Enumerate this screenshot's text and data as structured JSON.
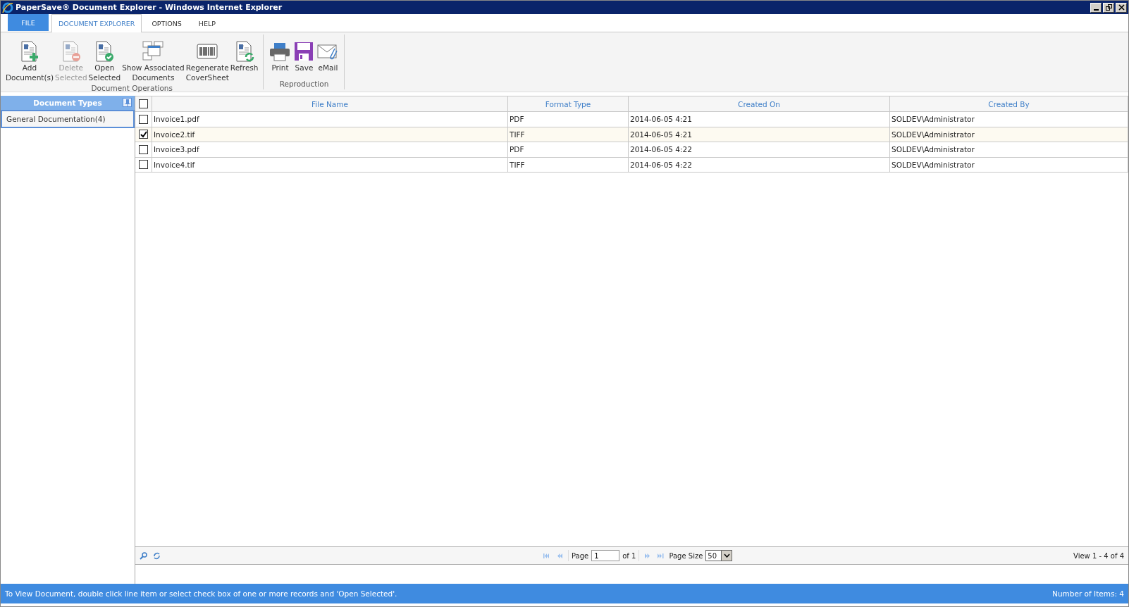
{
  "window": {
    "title": "PaperSave® Document Explorer - Windows Internet Explorer"
  },
  "ribbon_tabs": [
    {
      "label": "FILE",
      "kind": "file",
      "selected": false
    },
    {
      "label": "DOCUMENT EXPLORER",
      "kind": "tab",
      "selected": true
    },
    {
      "label": "OPTIONS",
      "kind": "tab",
      "selected": false
    },
    {
      "label": "HELP",
      "kind": "tab",
      "selected": false
    }
  ],
  "ribbon_groups": [
    {
      "label": "Document Operations",
      "buttons": [
        {
          "label": "Add\nDocument(s)",
          "kind": "add",
          "disabled": false
        },
        {
          "label": "Delete\nSelected",
          "kind": "delete",
          "disabled": true
        },
        {
          "label": "Open\nSelected",
          "kind": "open",
          "disabled": false
        },
        {
          "label": "Show Associated\nDocuments",
          "kind": "windows",
          "disabled": false
        },
        {
          "label": "Regenerate\nCoverSheet",
          "kind": "barcode",
          "disabled": false
        },
        {
          "label": "Refresh",
          "kind": "refresh",
          "disabled": false
        }
      ]
    },
    {
      "label": "Reproduction",
      "buttons": [
        {
          "label": "Print",
          "kind": "print",
          "disabled": false
        },
        {
          "label": "Save",
          "kind": "save",
          "disabled": false
        },
        {
          "label": "eMail",
          "kind": "email",
          "disabled": false
        }
      ]
    }
  ],
  "sidebar": {
    "title": "Document Types",
    "items": [
      {
        "label": "General Documentation(4)",
        "selected": true
      }
    ]
  },
  "table": {
    "all_checked": false,
    "columns": [
      "File Name",
      "Format Type",
      "Created On",
      "Created By"
    ],
    "rows": [
      {
        "checked": false,
        "cells": [
          "Invoice1.pdf",
          "PDF",
          "2014-06-05 4:21",
          "SOLDEV\\Administrator"
        ]
      },
      {
        "checked": true,
        "cells": [
          "Invoice2.tif",
          "TIFF",
          "2014-06-05 4:21",
          "SOLDEV\\Administrator"
        ]
      },
      {
        "checked": false,
        "cells": [
          "Invoice3.pdf",
          "PDF",
          "2014-06-05 4:22",
          "SOLDEV\\Administrator"
        ]
      },
      {
        "checked": false,
        "cells": [
          "Invoice4.tif",
          "TIFF",
          "2014-06-05 4:22",
          "SOLDEV\\Administrator"
        ]
      }
    ]
  },
  "pager": {
    "page_label": "Page",
    "page": "1",
    "of": "of 1",
    "size_label": "Page Size",
    "size": "50",
    "view": "View 1 - 4 of 4"
  },
  "status_bar": {
    "message": "To View Document, double click line item or select check box of one or more records and 'Open Selected'.",
    "count": "Number of Items: 4"
  }
}
